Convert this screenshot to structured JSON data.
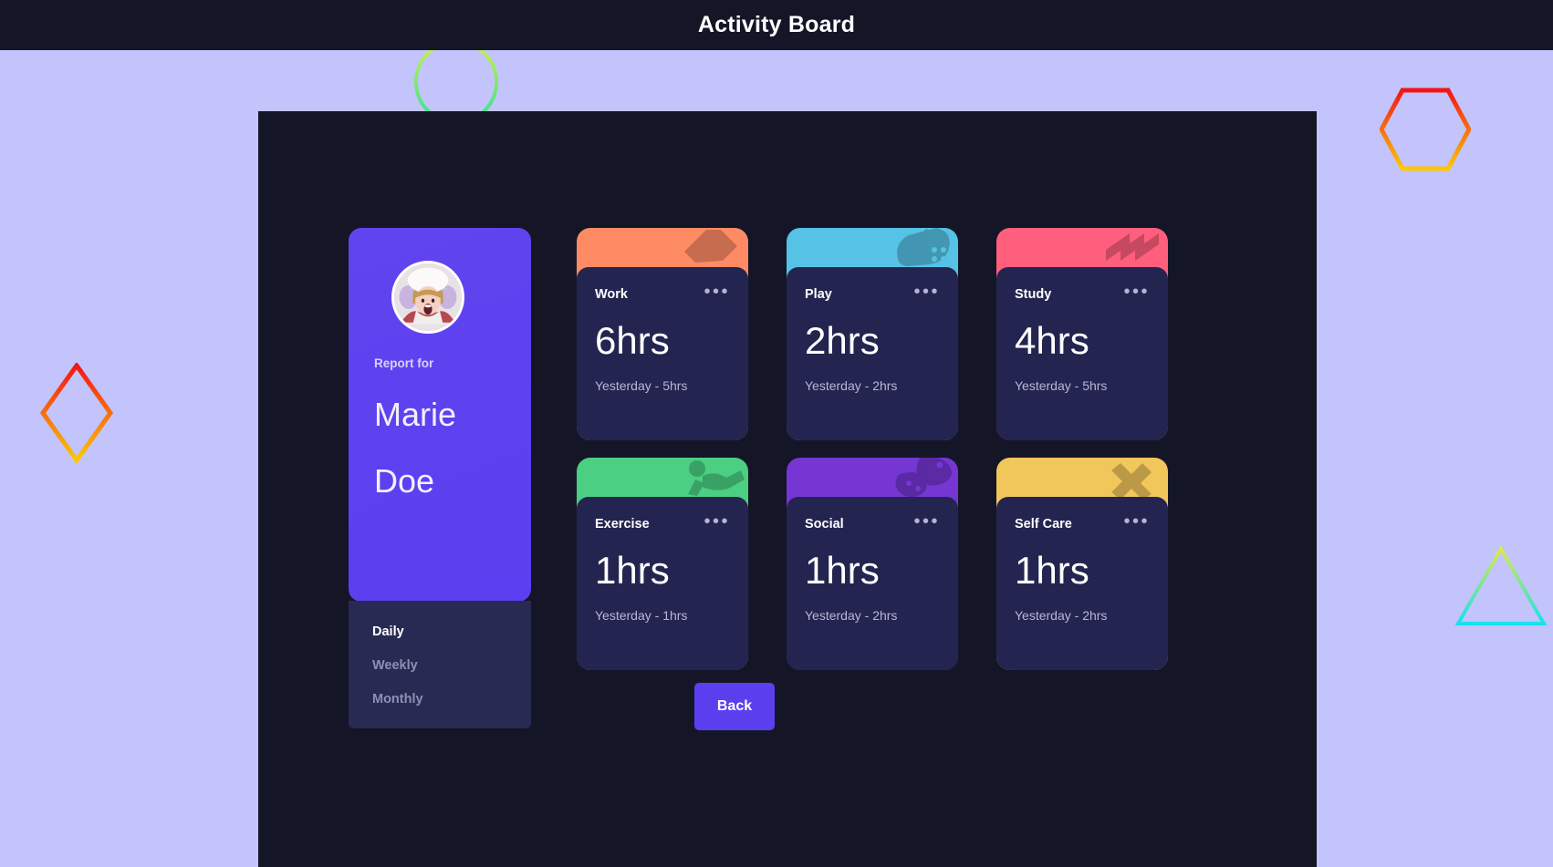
{
  "header": {
    "title": "Activity Board"
  },
  "profile": {
    "avatar_alt": "avatar",
    "report_label": "Report for",
    "first_name": "Marie",
    "last_name": "Doe",
    "ranges": [
      {
        "label": "Daily",
        "active": true
      },
      {
        "label": "Weekly",
        "active": false
      },
      {
        "label": "Monthly",
        "active": false
      }
    ]
  },
  "cards": [
    {
      "title": "Work",
      "hours": "6hrs",
      "previous": "Yesterday - 5hrs",
      "color": "#ff8b64",
      "deco": "briefcase-icon",
      "menu": "•••"
    },
    {
      "title": "Play",
      "hours": "2hrs",
      "previous": "Yesterday - 2hrs",
      "color": "#55c2e6",
      "deco": "gamepad-icon",
      "menu": "•••"
    },
    {
      "title": "Study",
      "hours": "4hrs",
      "previous": "Yesterday - 5hrs",
      "color": "#ff5e7d",
      "deco": "book-icon",
      "menu": "•••"
    },
    {
      "title": "Exercise",
      "hours": "1hrs",
      "previous": "Yesterday - 1hrs",
      "color": "#4bcf82",
      "deco": "dumbbell-icon",
      "menu": "•••"
    },
    {
      "title": "Social",
      "hours": "1hrs",
      "previous": "Yesterday - 2hrs",
      "color": "#7536d3",
      "deco": "chat-icon",
      "menu": "•••"
    },
    {
      "title": "Self Care",
      "hours": "1hrs",
      "previous": "Yesterday - 2hrs",
      "color": "#f1c65b",
      "deco": "star-icon",
      "menu": "•••"
    }
  ],
  "footer": {
    "back_label": "Back"
  },
  "colors": {
    "page_background": "#c2c4fb",
    "panel_background": "#141627",
    "header_background": "#141627",
    "profile_accent": "#5b3ff0",
    "card_inner": "#242450",
    "range_active": "#ffffff",
    "range_inactive": "#8f8fb4"
  },
  "decor_shapes": [
    {
      "name": "circle-outline",
      "gradient_from": "#d4ec4e",
      "gradient_to": "#2ce68e"
    },
    {
      "name": "hexagon-outline",
      "gradient_from": "#f41414",
      "gradient_to": "#fbc80a"
    },
    {
      "name": "diamond-outline",
      "gradient_from": "#f41414",
      "gradient_to": "#fbc80a"
    },
    {
      "name": "triangle-outline",
      "gradient_from": "#dbe94a",
      "gradient_to": "#18e0f0"
    }
  ]
}
